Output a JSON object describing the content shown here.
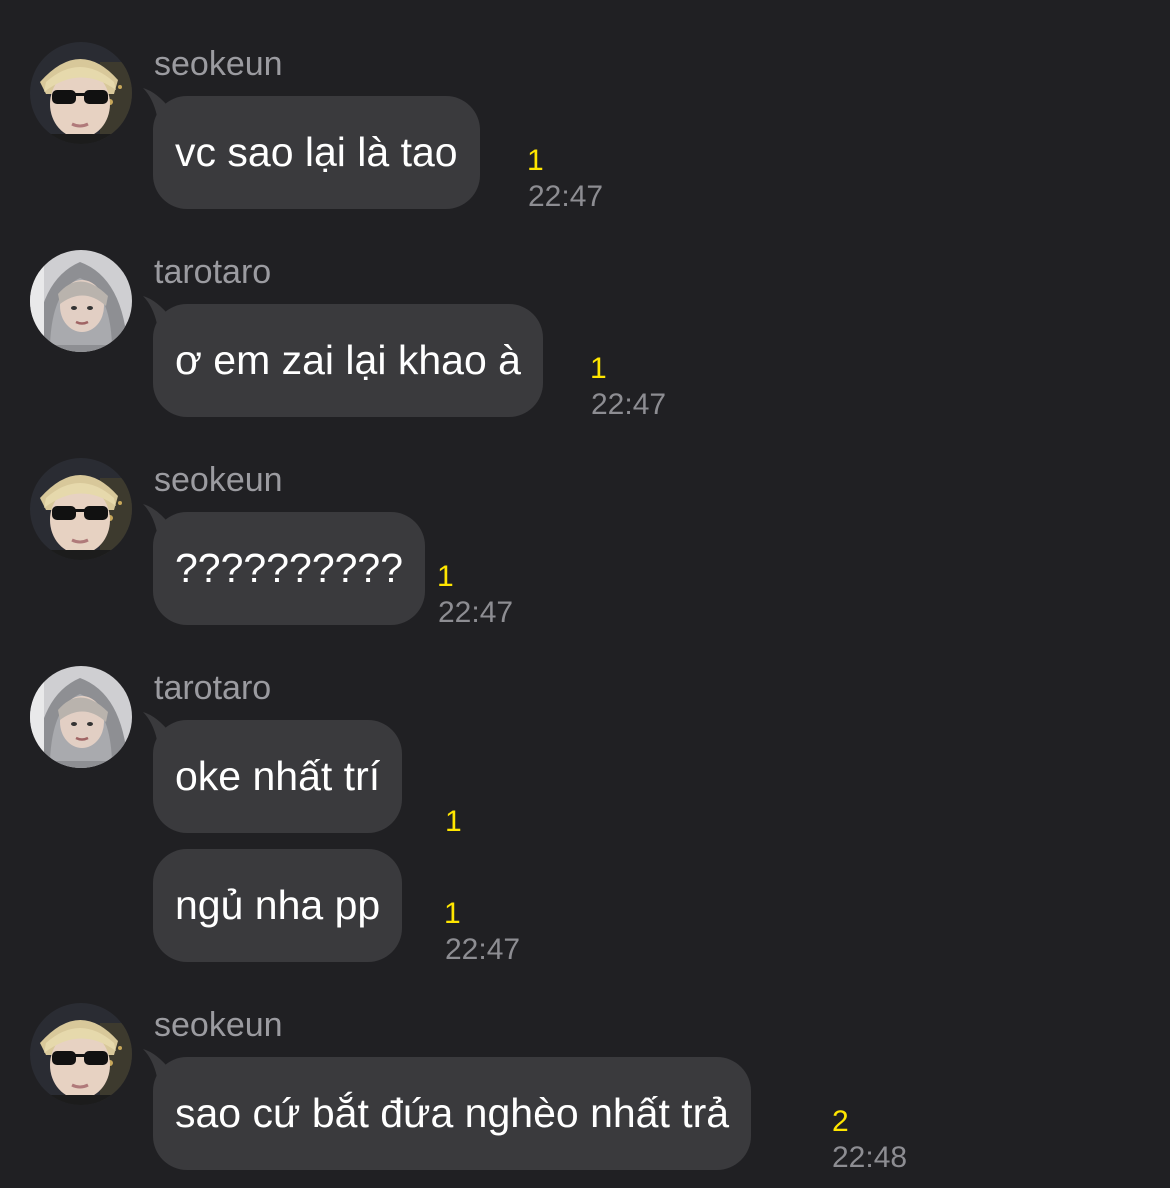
{
  "messages": [
    {
      "sender": "seokeun",
      "avatar_icon": "avatar-blonde-sunglasses",
      "text": "vc sao lại là tao",
      "unread": "1",
      "time": "22:47"
    },
    {
      "sender": "tarotaro",
      "avatar_icon": "avatar-grey-hoodie",
      "text": "ơ em zai lại khao à",
      "unread": "1",
      "time": "22:47"
    },
    {
      "sender": "seokeun",
      "avatar_icon": "avatar-blonde-sunglasses",
      "text": "??????????",
      "unread": "1",
      "time": "22:47"
    },
    {
      "sender": "tarotaro",
      "avatar_icon": "avatar-grey-hoodie",
      "text": "oke nhất trí",
      "unread": "1",
      "time": ""
    },
    {
      "sender": "",
      "avatar_icon": "",
      "text": "ngủ nha pp",
      "unread": "1",
      "time": "22:47"
    },
    {
      "sender": "seokeun",
      "avatar_icon": "avatar-blonde-sunglasses",
      "text": "sao cứ bắt đứa nghèo nhất trả",
      "unread": "2",
      "time": "22:48"
    }
  ],
  "colors": {
    "background": "#202023",
    "bubble": "#3a3a3d",
    "unread": "#ffe600",
    "time": "#8d8d92",
    "sender": "#9b9ba0"
  }
}
